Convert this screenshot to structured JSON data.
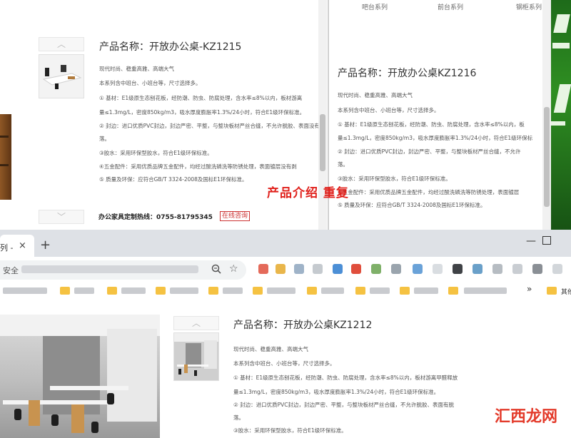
{
  "top_left_page": {
    "title": "产品名称：开放办公桌-KZ1215",
    "lines": [
      "现代时尚、稳重高雅、高端大气",
      "本系列含中班台、小班台等，尺寸选择多。",
      "① 基材：E1级原生态刨花板，经防潮、防虫、防腐处理，含水率≤8%以内，板材游离",
      "量≤1.3mg/L，密度850kg/m3，吸水厚度膨胀率1.3%/24小时，符合E1级环保标准。",
      "② 封边：进口优质PVC封边，封边严密、平整，与整块板材严丝合缝，不允许脱胶、表面没有脱",
      "落。",
      "③胶水：采用环保型胶水，符合E1级环保标准。",
      "④五金配件：采用优质品牌五金配件，均经过酸洗磷洗等防锈处理，表面镀层没有剥",
      "⑤ 质量及环保：应符合GB/T 3324-2008及国标E1环保标准。"
    ],
    "hotline": "办公家具定制热线：0755-81795345",
    "consult_button": "在线咨询",
    "thumb_up": "︿",
    "thumb_down": "﹀"
  },
  "top_right_page": {
    "nav": [
      "吧台系列",
      "前台系列",
      "钢柜系列"
    ],
    "title": "产品名称：开放办公桌KZ1216",
    "lines": [
      "现代时尚、稳重高雅、高端大气",
      "本系列含中班台、小班台等，尺寸选择多。",
      "① 基材：E1级原生态刨花板，经防潮、防虫、防腐处理，含水率≤8%以内，板",
      "量≤1.3mg/L，密度850kg/m3，吸水厚度膨胀率1.3%/24小时，符合E1级环保标",
      "② 封边：进口优质PVC封边，封边严密、平整，与整块板材严丝合缝，不允许",
      "落。",
      "③胶水：采用环保型胶水，符合E1级环保标准。",
      "④五金配件：采用优质品牌五金配件，均经过酸洗磷洗等防锈处理，表面镀层",
      "⑤ 质量及环保：应符合GB/T 3324-2008及国标E1环保标准。"
    ]
  },
  "annotation": "产品介绍 重复",
  "browser": {
    "tab_title": "列 -",
    "tab_close": "×",
    "new_tab": "+",
    "window_minimize": "—",
    "address_prefix": "安全",
    "star": "☆",
    "bookmarks_more": "»",
    "bookmarks_other": "其他"
  },
  "bottom_page": {
    "title": "产品名称：开放办公桌KZ1212",
    "lines": [
      "现代时尚、稳重高雅、高端大气",
      "本系列含中班台、小班台等，尺寸选择多。",
      "① 基材：E1级原生态刨花板，经防潮、防虫、防腐处理，含水率≤8%以内，板材游离甲醛释放",
      "量≤1.3mg/L，密度850kg/m3，吸水厚度膨胀率1.3%/24小时，符合E1级环保标准。",
      "② 封边：进口优质PVC封边，封边严密、平整，与整块板材严丝合缝，不允许脱胶、表面有脱",
      "落。",
      "③胶水：采用环保型胶水，符合E1级环保标准。"
    ],
    "thumb_up": "︿"
  },
  "watermark": "汇西龙网",
  "colors": {
    "annotation_red": "#e0201b",
    "poster_green": "#2f8f22",
    "watermark_red": "#e33a2a",
    "consult_red": "#cc3333"
  }
}
